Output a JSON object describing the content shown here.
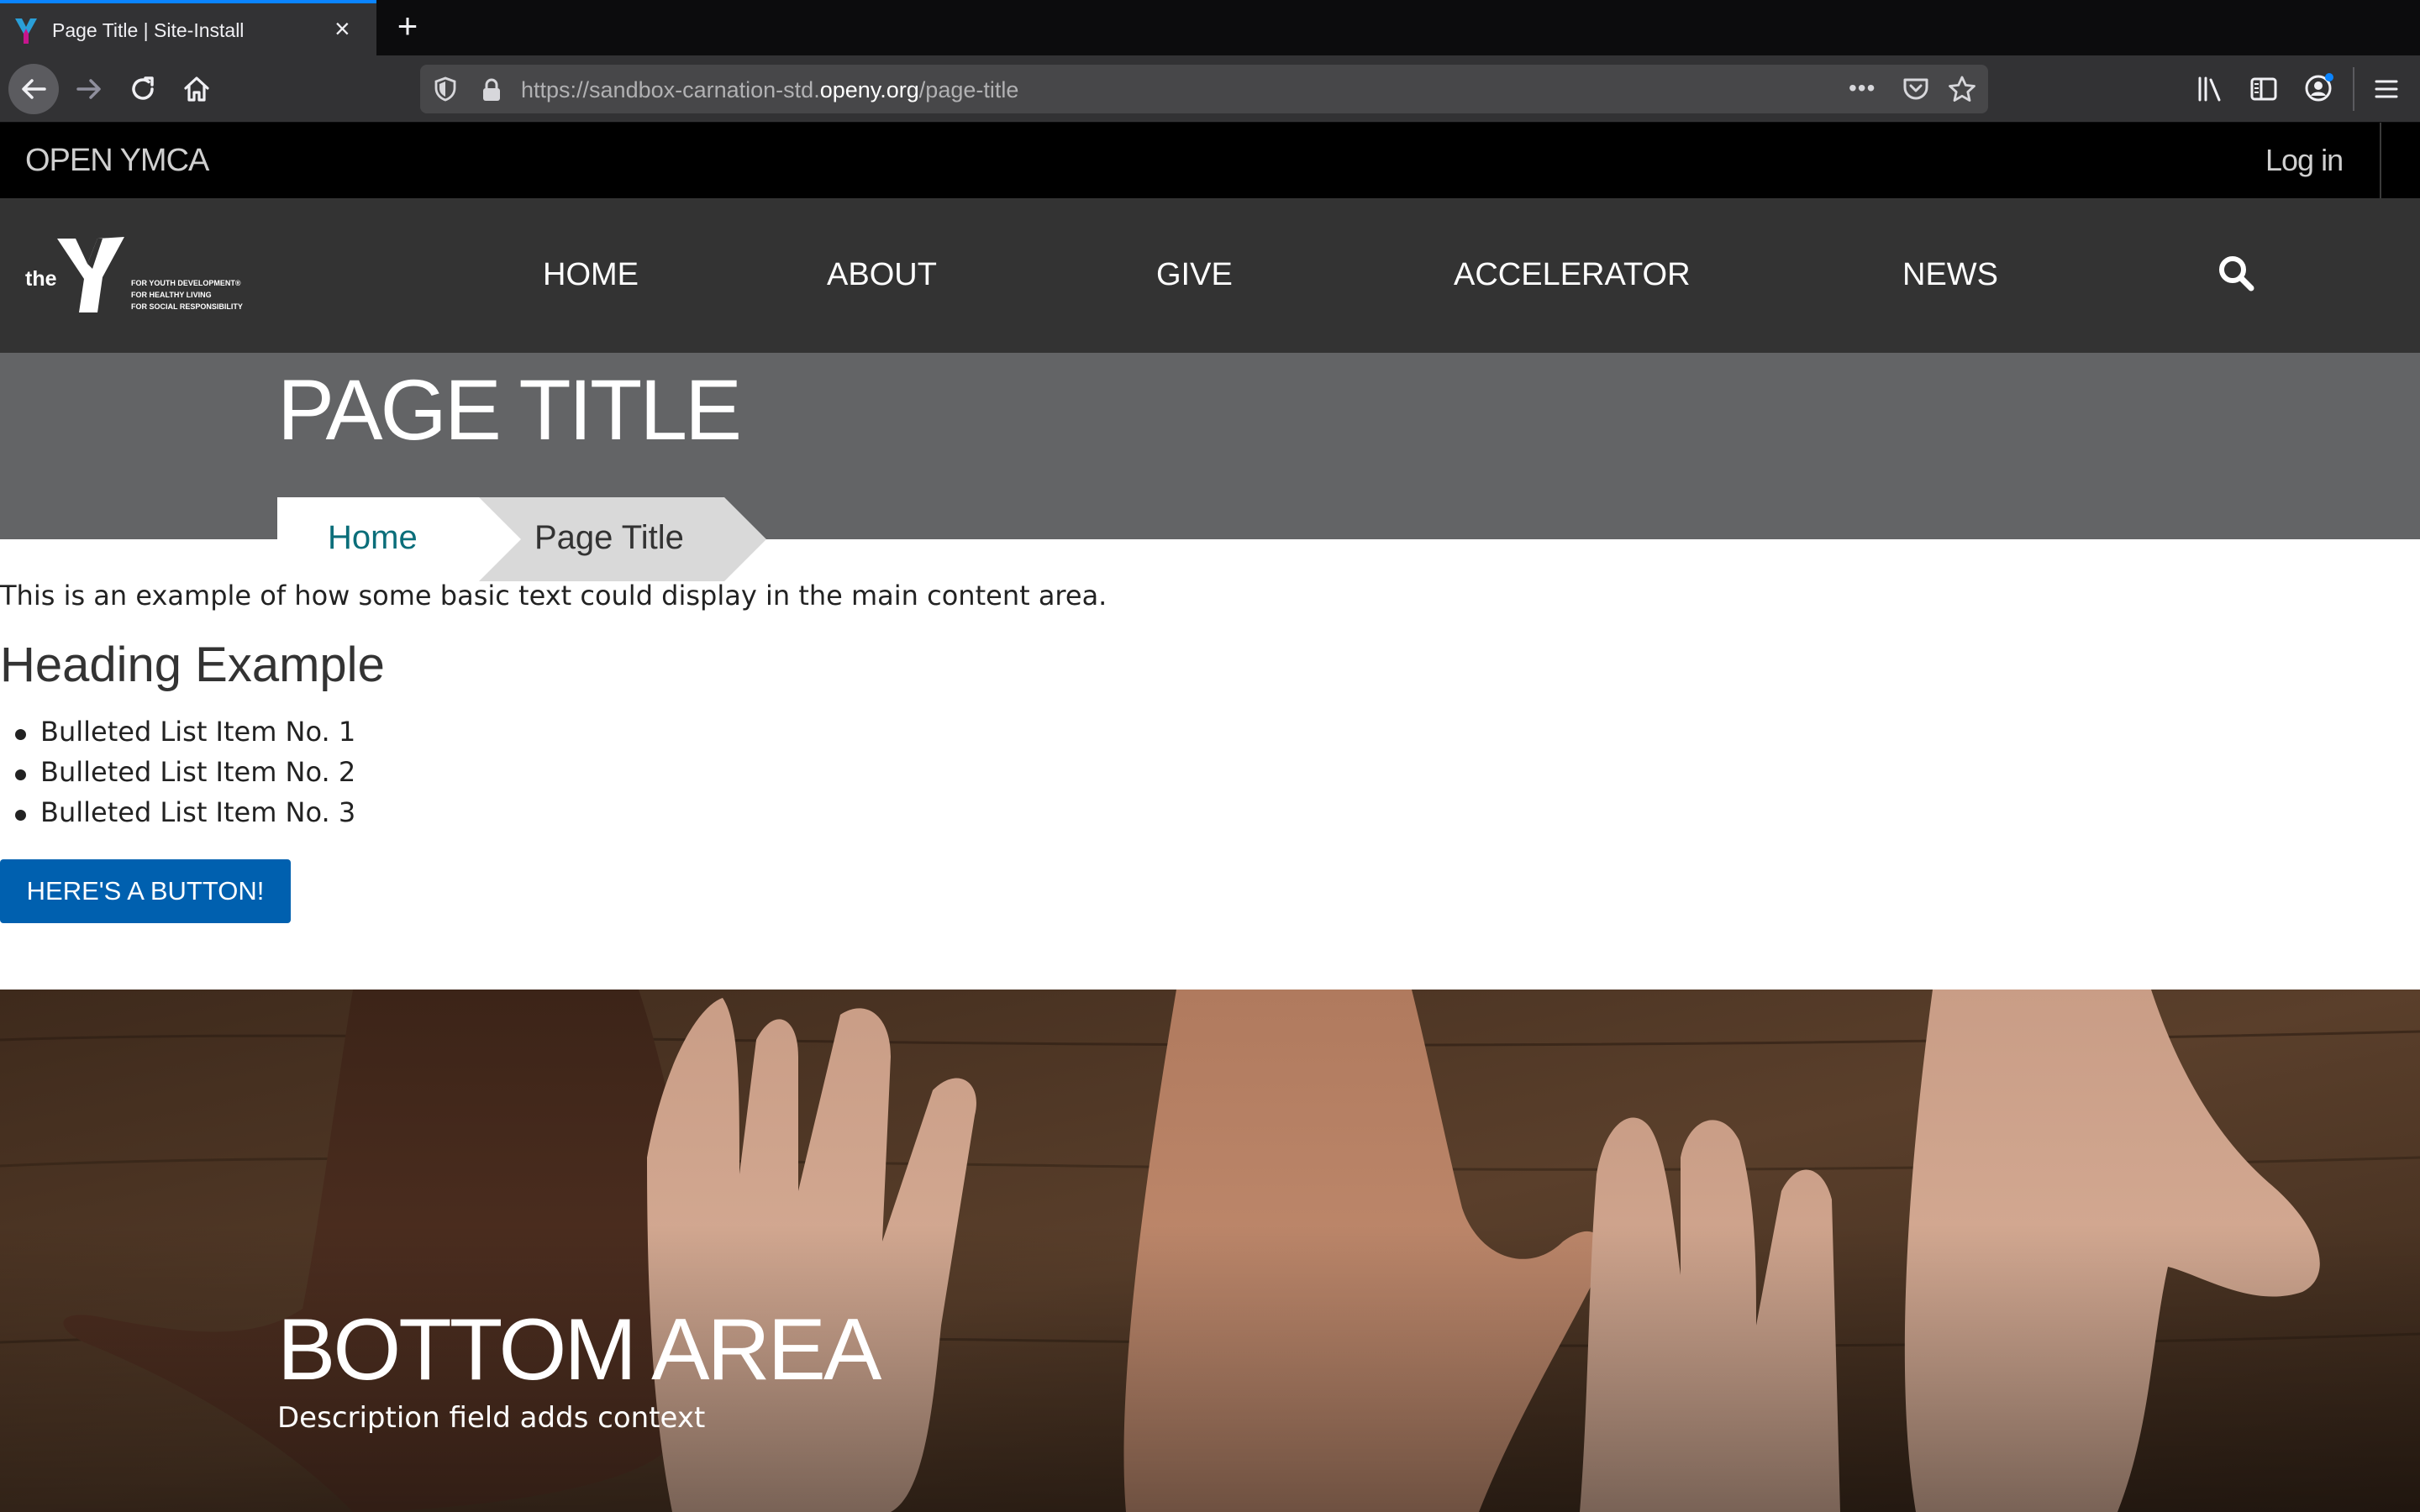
{
  "browser": {
    "tab_title": "Page Title | Site-Install",
    "close_glyph": "×",
    "new_tab_glyph": "+",
    "url": {
      "prefix": "https://sandbox-carnation-std.",
      "domain": "openy.org",
      "path": "/page-title"
    },
    "more_glyph": "•••",
    "accent_color": "#0a84ff"
  },
  "site": {
    "name": "OPEN YMCA",
    "login": "Log in",
    "logo": {
      "word": "the",
      "taglines": [
        "FOR YOUTH DEVELOPMENT®",
        "FOR HEALTHY LIVING",
        "FOR SOCIAL RESPONSIBILITY"
      ]
    },
    "nav": [
      "HOME",
      "ABOUT",
      "GIVE",
      "ACCELERATOR",
      "NEWS"
    ]
  },
  "page": {
    "title": "PAGE TITLE",
    "breadcrumb": {
      "home": "Home",
      "current": "Page Title"
    },
    "intro": "This is an example of how some basic text could display in the main content area.",
    "heading": "Heading Example",
    "bullets": [
      "Bulleted List Item No. 1",
      "Bulleted List Item No. 2",
      "Bulleted List Item No. 3"
    ],
    "button": "HERE'S A BUTTON!",
    "button_color": "#0060af"
  },
  "bottom": {
    "title": "BOTTOM AREA",
    "description": "Description field adds context"
  }
}
